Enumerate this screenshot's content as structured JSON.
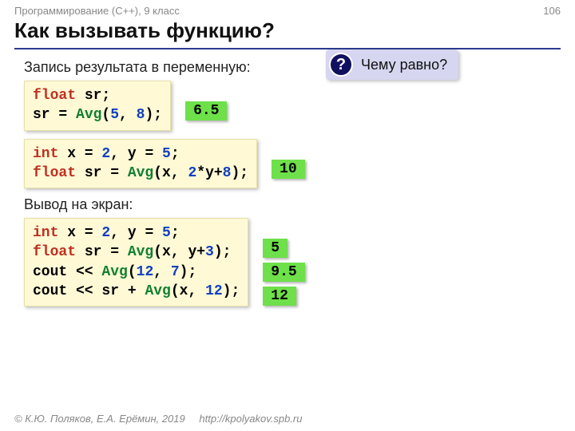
{
  "header": {
    "course": "Программирование (C++), 9 класс",
    "page_number": "106"
  },
  "title": "Как вызывать функцию?",
  "question": {
    "mark": "?",
    "text": "Чему равно?"
  },
  "sections": {
    "store": "Запись результата в переменную:",
    "output": "Вывод на экран:"
  },
  "code": {
    "block1": {
      "t1a": "float",
      "t1b": " sr;",
      "t2a": "sr = ",
      "t2b": "Avg",
      "t2c": "(",
      "t2d": "5",
      "t2e": ", ",
      "t2f": "8",
      "t2g": ");"
    },
    "block2": {
      "t1a": "int",
      "t1b": " x = ",
      "t1c": "2",
      "t1d": ", y = ",
      "t1e": "5",
      "t1f": ";",
      "t2a": "float",
      "t2b": " sr = ",
      "t2c": "Avg",
      "t2d": "(x, ",
      "t2e": "2",
      "t2f": "*y+",
      "t2g": "8",
      "t2h": ");"
    },
    "block3": {
      "t1a": "int",
      "t1b": " x = ",
      "t1c": "2",
      "t1d": ", y = ",
      "t1e": "5",
      "t1f": ";",
      "t2a": "float",
      "t2b": " sr = ",
      "t2c": "Avg",
      "t2d": "(x, y+",
      "t2e": "3",
      "t2f": ");",
      "t3a": "cout << ",
      "t3b": "Avg",
      "t3c": "(",
      "t3d": "12",
      "t3e": ", ",
      "t3f": "7",
      "t3g": ");",
      "t4a": "cout << sr + ",
      "t4b": "Avg",
      "t4c": "(x, ",
      "t4d": "12",
      "t4e": ");"
    }
  },
  "answers": {
    "a1": "6.5",
    "a2": "10",
    "a3_1": "5",
    "a3_2": "9.5",
    "a3_3": "12"
  },
  "footer": {
    "copyright": "© К.Ю. Поляков, Е.А. Ерёмин, 2019",
    "url": "http://kpolyakov.spb.ru"
  }
}
